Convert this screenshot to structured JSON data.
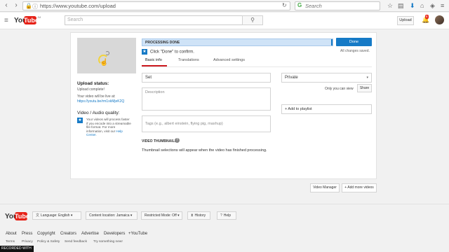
{
  "browser": {
    "url": "https://www.youtube.com/upload",
    "search_placeholder": "Search"
  },
  "header": {
    "logo_you": "You",
    "logo_tube": "Tube",
    "logo_suffix": "JM",
    "search_placeholder": "Search",
    "upload_label": "Upload",
    "notification_count": "6"
  },
  "sidebar": {
    "upload_status_label": "Upload status:",
    "upload_complete": "Upload complete!",
    "live_at_text": "Your video will be live at:",
    "video_link": "https://youtu.be/rm1xkMjeK2Q",
    "quality_label": "Video / Audio quality:",
    "quality_text_before": "Your videos will process faster if you encode into a streamable file format. For more information, visit our ",
    "help_center": "Help Center."
  },
  "status": {
    "processing_text": "PROCESSING DONE",
    "progress_percent": 100,
    "done_label": "Done",
    "saved_text": "All changes saved.",
    "confirm_text": "Click \"Done\" to confirm."
  },
  "tabs": [
    "Basic info",
    "Translations",
    "Advanced settings"
  ],
  "form": {
    "title_value": "Set",
    "description_placeholder": "Description",
    "tags_placeholder": "Tags (e.g., albert einstein, flying pig, mashup)",
    "privacy_value": "Private",
    "only_you": "Only you can view",
    "share_label": "Share",
    "playlist_label": "+ Add to playlist"
  },
  "thumbnails": {
    "title": "VIDEO THUMBNAILS",
    "text": "Thumbnail selections will appear when the video has finished processing."
  },
  "bottom_buttons": {
    "video_manager": "Video Manager",
    "add_more": "+ Add more videos"
  },
  "footer": {
    "language": "Language: English",
    "location": "Content location: Jamaica",
    "restricted": "Restricted Mode: Off",
    "history": "History",
    "help": "Help",
    "links1": [
      "About",
      "Press",
      "Copyright",
      "Creators",
      "Advertise",
      "Developers",
      "+YouTube"
    ],
    "links2": [
      "Terms",
      "Privacy",
      "Policy & Safety",
      "Send feedback",
      "Try something new!"
    ],
    "recorded": "RECORDED WITH"
  }
}
